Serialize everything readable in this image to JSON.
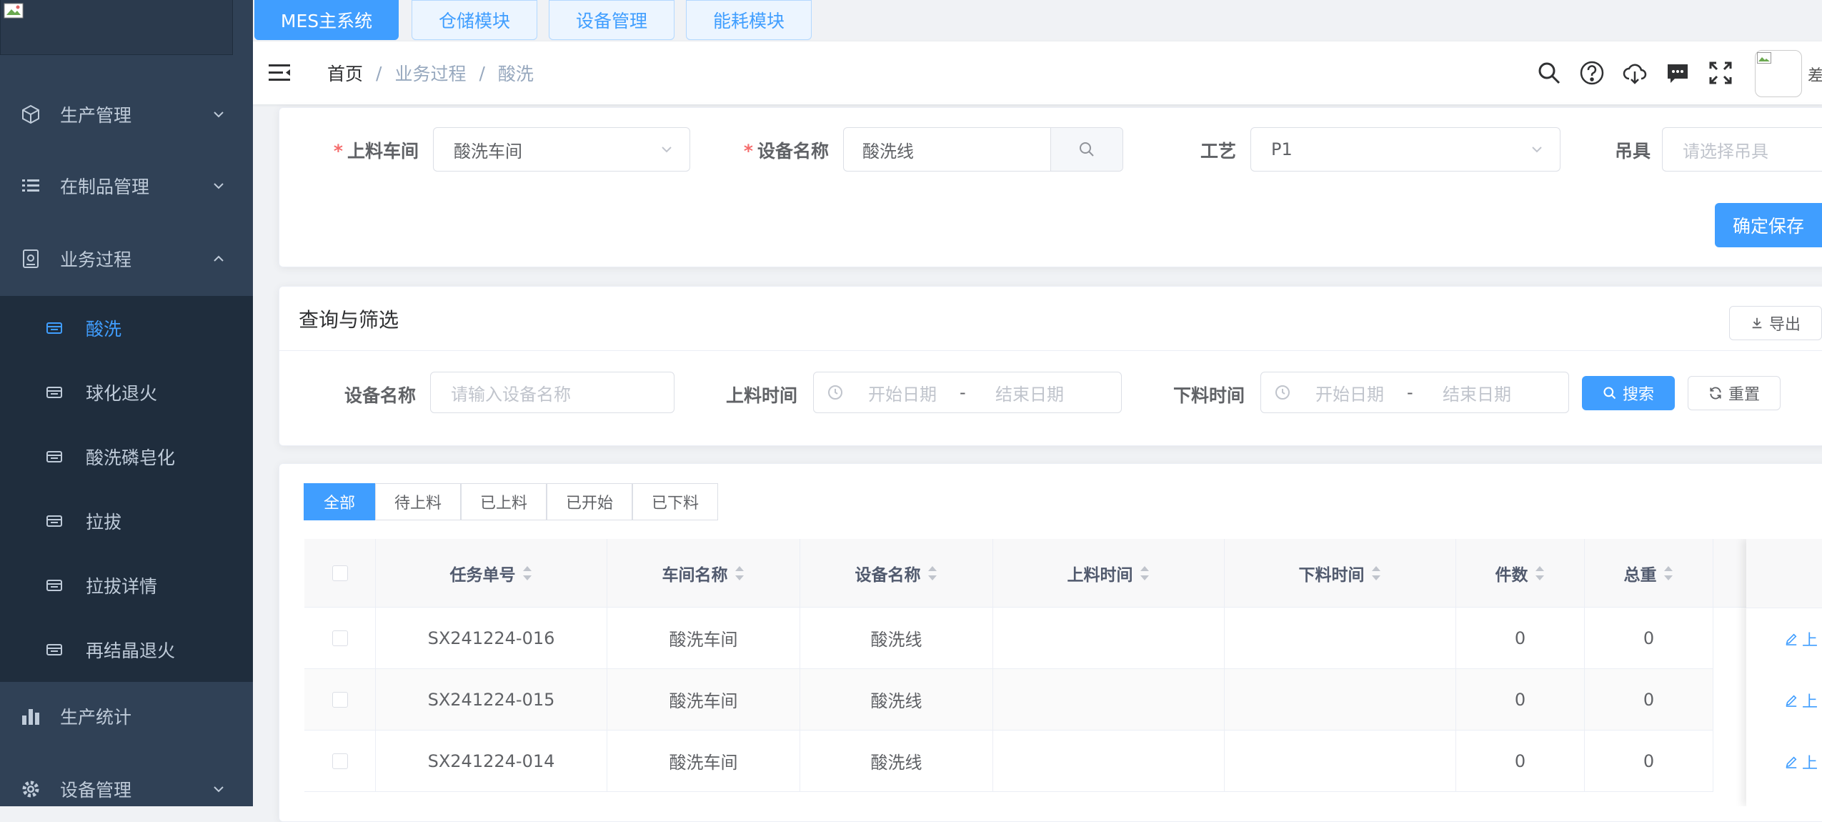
{
  "module_tabs": [
    "MES主系统",
    "仓储模块",
    "设备管理",
    "能耗模块"
  ],
  "sidebar": {
    "menus": [
      {
        "label": "生产管理",
        "icon": "cube-icon",
        "expanded": false
      },
      {
        "label": "在制品管理",
        "icon": "list-icon",
        "expanded": false
      },
      {
        "label": "业务过程",
        "icon": "process-icon",
        "expanded": true
      }
    ],
    "sub_items": [
      {
        "label": "酸洗",
        "active": true
      },
      {
        "label": "球化退火",
        "active": false
      },
      {
        "label": "酸洗磷皂化",
        "active": false
      },
      {
        "label": "拉拔",
        "active": false
      },
      {
        "label": "拉拔详情",
        "active": false
      },
      {
        "label": "再结晶退火",
        "active": false
      }
    ],
    "bottom_menus": [
      {
        "label": "生产统计",
        "icon": "bar-chart-icon"
      },
      {
        "label": "设备管理",
        "icon": "gear-icon"
      }
    ]
  },
  "breadcrumb": {
    "home": "首页",
    "parent": "业务过程",
    "current": "酸洗",
    "sep": "/"
  },
  "user_name_truncated": "差",
  "form": {
    "workshop_label": "上料车间",
    "workshop_value": "酸洗车间",
    "device_label": "设备名称",
    "device_value": "酸洗线",
    "process_label": "工艺",
    "process_value": "P1",
    "hanger_label": "吊具",
    "hanger_placeholder": "请选择吊具",
    "required_mark": "*",
    "save_button": "确定保存"
  },
  "filter": {
    "title": "查询与筛选",
    "export_button": "导出",
    "device_label": "设备名称",
    "device_placeholder": "请输入设备名称",
    "load_time_label": "上料时间",
    "unload_time_label": "下料时间",
    "start_placeholder": "开始日期",
    "end_placeholder": "结束日期",
    "range_sep": "-",
    "search_button": "搜索",
    "reset_button": "重置"
  },
  "status_tabs": [
    "全部",
    "待上料",
    "已上料",
    "已开始",
    "已下料"
  ],
  "table": {
    "columns": [
      "任务单号",
      "车间名称",
      "设备名称",
      "上料时间",
      "下料时间",
      "件数",
      "总重"
    ],
    "rows": [
      {
        "task_no": "SX241224-016",
        "workshop": "酸洗车间",
        "device": "酸洗线",
        "load_time": "",
        "unload_time": "",
        "count": "0",
        "weight": "0"
      },
      {
        "task_no": "SX241224-015",
        "workshop": "酸洗车间",
        "device": "酸洗线",
        "load_time": "",
        "unload_time": "",
        "count": "0",
        "weight": "0"
      },
      {
        "task_no": "SX241224-014",
        "workshop": "酸洗车间",
        "device": "酸洗线",
        "load_time": "",
        "unload_time": "",
        "count": "0",
        "weight": "0"
      }
    ],
    "action_label_truncated": "上"
  },
  "colors": {
    "sidebar_bg": "#304156",
    "primary": "#409eff",
    "sidebar_text": "#bfcbd9",
    "required": "#f56c6c"
  }
}
